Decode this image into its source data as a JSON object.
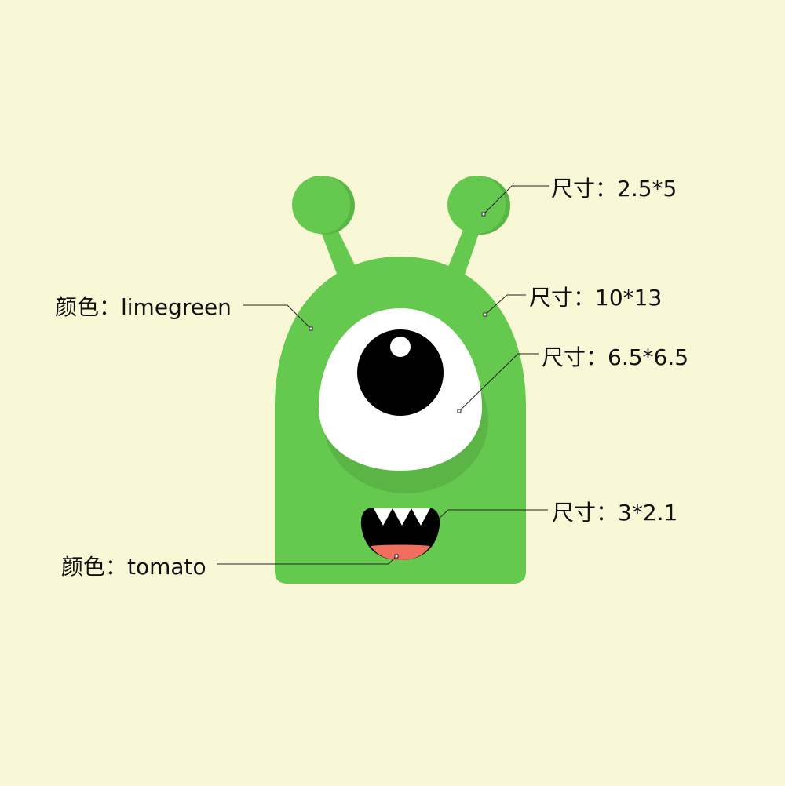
{
  "colors": {
    "background": "#f8f8d6",
    "body": "#66c94f",
    "body_shadow": "#5ab546",
    "eye_white": "#ffffff",
    "pupil": "#000000",
    "mouth": "#000000",
    "tongue": "#ef6e5e",
    "leader_line": "#222222",
    "label_text": "#111111"
  },
  "annotations": {
    "antenna_size": "尺寸：2.5*5",
    "body_color": "颜色：limegreen",
    "body_size": "尺寸：10*13",
    "eye_size": "尺寸：6.5*6.5",
    "mouth_size": "尺寸：3*2.1",
    "tongue_color": "颜色：tomato"
  }
}
